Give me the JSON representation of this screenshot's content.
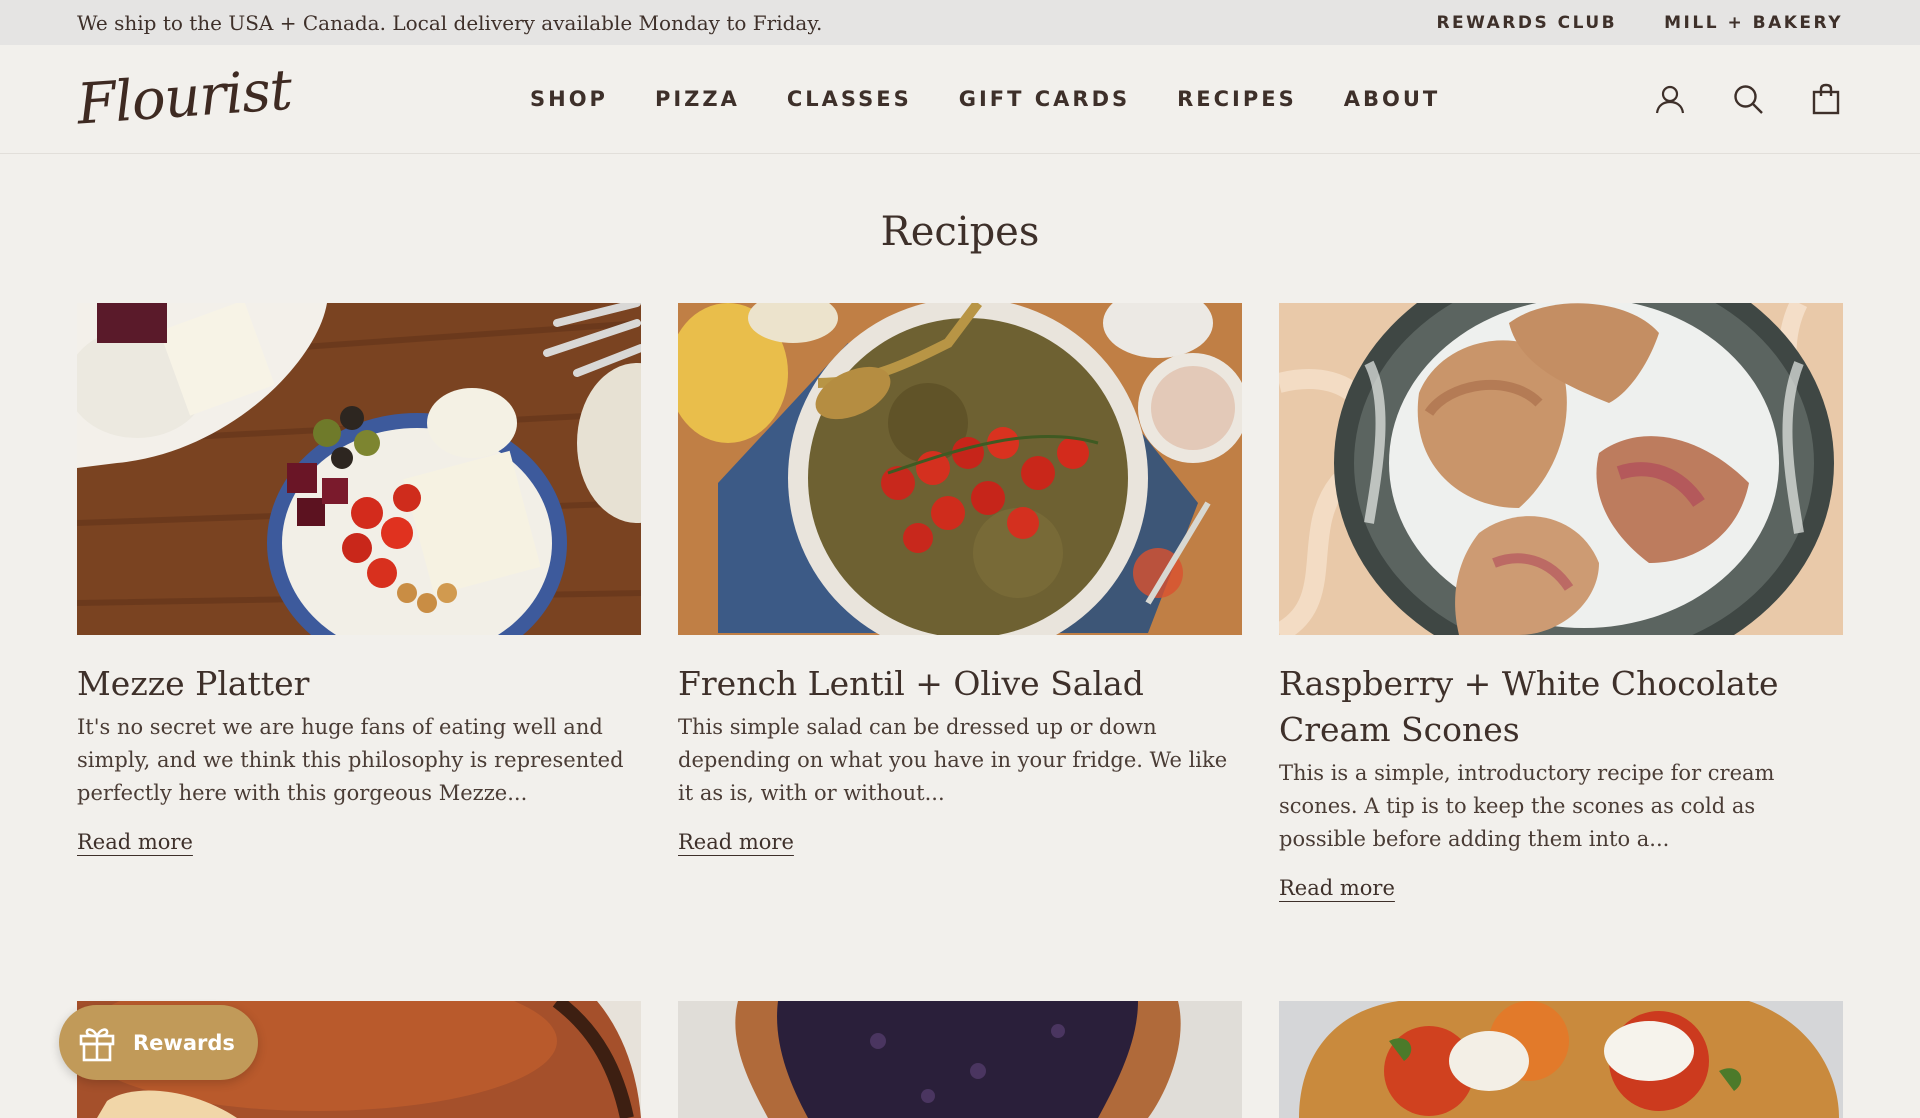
{
  "announcement": {
    "message": "We ship to the USA + Canada. Local delivery available Monday to Friday.",
    "links": [
      "REWARDS CLUB",
      "MILL + BAKERY"
    ]
  },
  "header": {
    "logo": "Flourist",
    "nav": [
      "SHOP",
      "PIZZA",
      "CLASSES",
      "GIFT CARDS",
      "RECIPES",
      "ABOUT"
    ],
    "icons": [
      "account-icon",
      "search-icon",
      "cart-icon"
    ]
  },
  "page": {
    "title": "Recipes"
  },
  "recipes": [
    {
      "title": "Mezze Platter",
      "excerpt": "It's no secret we are huge fans of eating well and simply, and we think this philosophy is represented perfectly here with this gorgeous Mezze...",
      "link": "Read more"
    },
    {
      "title": "French Lentil + Olive Salad",
      "excerpt": "This simple salad can be dressed up or down depending on what you have in your fridge. We like it as is, with or without...",
      "link": "Read more"
    },
    {
      "title": "Raspberry + White Chocolate Cream Scones",
      "excerpt": "This is a simple, introductory recipe for cream scones. A tip is to keep the scones as cold as possible before adding them into a...",
      "link": "Read more"
    }
  ],
  "rewards_button": {
    "label": "Rewards",
    "icon": "gift-icon"
  },
  "colors": {
    "background": "#f2f0ec",
    "announcement_bar": "#e5e4e3",
    "text": "#3e302a",
    "rewards": "#c19a59"
  }
}
